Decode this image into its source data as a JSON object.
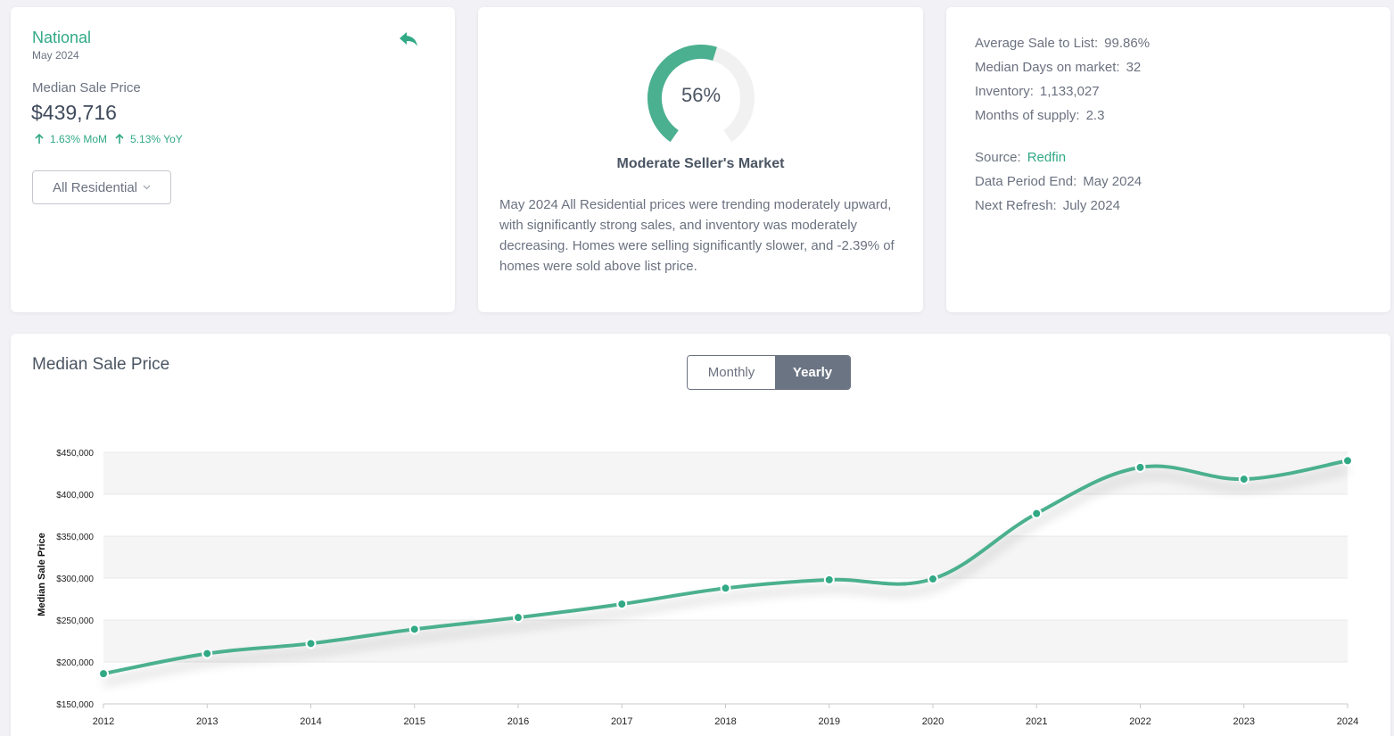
{
  "summary_card": {
    "region": "National",
    "period": "May 2024",
    "price_label": "Median Sale Price",
    "price_value": "$439,716",
    "mom": "1.63% MoM",
    "yoy": "5.13% YoY",
    "property_type": "All Residential"
  },
  "market_card": {
    "gauge_value": 56,
    "gauge_text": "56%",
    "market_label": "Moderate Seller's Market",
    "summary": "May 2024 All Residential prices were trending moderately upward, with significantly strong sales, and inventory was moderately decreasing. Homes were selling significantly slower, and -2.39% of homes were sold above list price."
  },
  "stats_card": {
    "stats": [
      {
        "label": "Average Sale to List:",
        "value": "99.86%"
      },
      {
        "label": "Median Days on market:",
        "value": "32"
      },
      {
        "label": "Inventory:",
        "value": "1,133,027"
      },
      {
        "label": "Months of supply:",
        "value": "2.3"
      }
    ],
    "meta": [
      {
        "label": "Source:",
        "value": "Redfin"
      },
      {
        "label": "Data Period End:",
        "value": "May 2024"
      },
      {
        "label": "Next Refresh:",
        "value": "July 2024"
      }
    ]
  },
  "chart_card": {
    "title": "Median Sale Price",
    "toggle": {
      "monthly": "Monthly",
      "yearly": "Yearly",
      "active": "yearly"
    }
  },
  "colors": {
    "accent": "#31a985",
    "toggle_active": "#6b7483"
  },
  "chart_data": {
    "type": "line",
    "title": "",
    "xlabel": "",
    "ylabel": "Median Sale Price",
    "x": [
      "2012",
      "2013",
      "2014",
      "2015",
      "2016",
      "2017",
      "2018",
      "2019",
      "2020",
      "2021",
      "2022",
      "2023",
      "2024"
    ],
    "series": [
      {
        "values": [
          186000,
          210000,
          222000,
          239000,
          253000,
          269000,
          288000,
          298000,
          299000,
          377000,
          432000,
          418000,
          440000
        ]
      }
    ],
    "yticks": [
      "$150,000",
      "$200,000",
      "$250,000",
      "$300,000",
      "$350,000",
      "$400,000",
      "$450,000"
    ],
    "ylim": [
      150000,
      450000
    ],
    "grid": true,
    "legend": "none"
  }
}
